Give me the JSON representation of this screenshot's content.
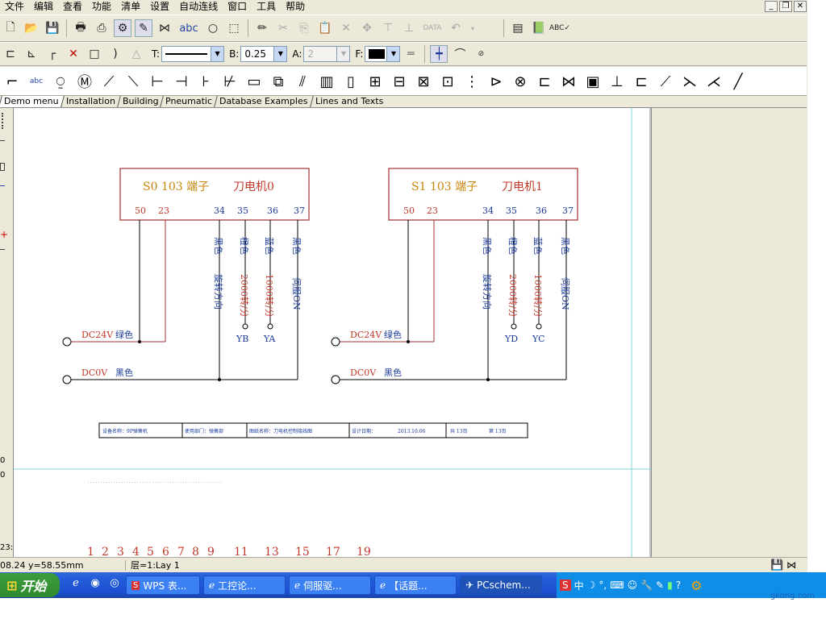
{
  "menu": {
    "items": [
      "文件",
      "编辑",
      "查看",
      "功能",
      "清单",
      "设置",
      "自动连线",
      "窗口",
      "工具",
      "帮助"
    ]
  },
  "toolbar2": {
    "t_label": "T:",
    "b_label": "B:",
    "b_value": "0.25",
    "a_label": "A:",
    "a_value": "2",
    "f_label": "F:"
  },
  "tabs": [
    "Demo menu",
    "Installation",
    "Building",
    "Pneumatic",
    "Database Examples",
    "Lines and Texts"
  ],
  "status": {
    "coords": "08.24 y=58.55mm",
    "layer": "层=1:Lay 1"
  },
  "taskbar": {
    "start": "开始",
    "tasks": [
      "WPS 表...",
      "工控论...",
      "伺服驱...",
      "【话题...",
      "PCschem..."
    ],
    "tray_text": "中"
  },
  "watermark": "gkong.com",
  "schematic": {
    "blocks": [
      {
        "title_left": "S0  103 端子",
        "title_right": "刀电机0",
        "pins": [
          "50",
          "23",
          "34",
          "35",
          "36",
          "37"
        ],
        "wire_colors": [
          "黑色",
          "橙色",
          "蓝色",
          "黑色"
        ],
        "functions": [
          "旋转方向",
          "2000转/分",
          "1000转/分",
          "伺服ON"
        ],
        "terms": [
          "YB",
          "YA"
        ]
      },
      {
        "title_left": "S1  103 端子",
        "title_right": "刀电机1",
        "pins": [
          "50",
          "23",
          "34",
          "35",
          "36",
          "37"
        ],
        "wire_colors": [
          "黑色",
          "橙色",
          "蓝色",
          "黑色"
        ],
        "functions": [
          "旋转方向",
          "2000转/分",
          "1000转/分",
          "伺服ON"
        ],
        "terms": [
          "YD",
          "YC"
        ]
      }
    ],
    "rail_dc24_label": "DC24V",
    "rail_dc24_color": "绿色",
    "rail_dc0_label": "DC0V",
    "rail_dc0_color": "黑色",
    "titleblock": [
      "设备名称：9P弹簧机",
      "使用部门：弹簧部",
      "图纸名称：刀电机控制接线图",
      "设计日期：",
      "2013.10.06",
      "共  13页",
      "第  13页"
    ],
    "column_numbers": [
      "1",
      "2",
      "3",
      "4",
      "5",
      "6",
      "7",
      "8",
      "9",
      "11",
      "13",
      "15",
      "17",
      "19"
    ],
    "left_ruler": [
      "0",
      "0",
      "23:"
    ]
  }
}
